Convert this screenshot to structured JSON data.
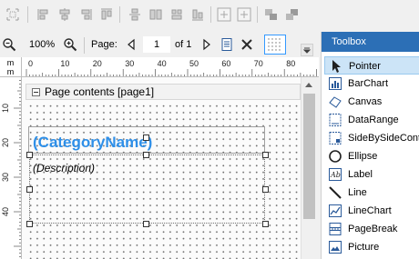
{
  "toolbar": {
    "icons": [
      "align-left-icon",
      "align-center-icon",
      "align-right-icon",
      "align-top-icon",
      "align-middle-icon",
      "align-bottom-icon",
      "make-same-width-icon",
      "make-same-height-icon",
      "make-same-size-icon",
      "center-horizontally-icon",
      "center-vertically-icon",
      "bring-to-front-icon",
      "send-to-back-icon"
    ]
  },
  "preview_bar": {
    "zoom_value": "100%",
    "page_label": "Page:",
    "page_number": "1",
    "of_label": "of 1"
  },
  "ruler": {
    "unit": "m\nm",
    "h_ticks": [
      "0",
      "10",
      "20",
      "30",
      "40",
      "50",
      "60",
      "70",
      "80"
    ],
    "v_ticks": [
      "10",
      "20",
      "30",
      "40"
    ]
  },
  "band": {
    "title": "Page contents [page1]"
  },
  "canvas": {
    "category_label": "(CategoryName)",
    "description_label": "(Description)",
    "category_color": "#2e8fe8"
  },
  "toolbox": {
    "title": "Toolbox",
    "header_color": "#2c6fb6",
    "selected_item": "Pointer",
    "items": [
      {
        "label": "Pointer",
        "icon": "pointer-icon"
      },
      {
        "label": "BarChart",
        "icon": "bar-chart-icon"
      },
      {
        "label": "Canvas",
        "icon": "canvas-icon"
      },
      {
        "label": "DataRange",
        "icon": "data-range-icon"
      },
      {
        "label": "SideBySideCont",
        "icon": "side-by-side-icon"
      },
      {
        "label": "Ellipse",
        "icon": "ellipse-icon"
      },
      {
        "label": "Label",
        "icon": "label-icon"
      },
      {
        "label": "Line",
        "icon": "line-icon"
      },
      {
        "label": "LineChart",
        "icon": "line-chart-icon"
      },
      {
        "label": "PageBreak",
        "icon": "page-break-icon"
      },
      {
        "label": "Picture",
        "icon": "picture-icon"
      }
    ]
  }
}
